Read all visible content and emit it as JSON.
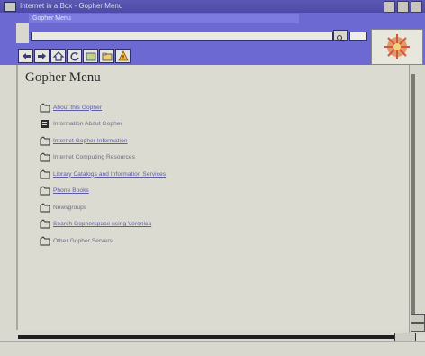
{
  "window": {
    "title": "Internet in a Box - Gopher Menu"
  },
  "menu_strip_text": "Gopher Menu",
  "address": {
    "value": ""
  },
  "toolbar": {
    "icons": [
      "back-icon",
      "forward-icon",
      "home-icon",
      "reload-icon",
      "images-icon",
      "open-icon",
      "stop-icon"
    ]
  },
  "page": {
    "title": "Gopher Menu",
    "items": [
      {
        "label": "About this Gopher",
        "type": "folder",
        "link": true
      },
      {
        "label": "Information About Gopher",
        "type": "document",
        "link": false
      },
      {
        "label": "Internet Gopher Information",
        "type": "folder",
        "link": true
      },
      {
        "label": "Internet Computing Resources",
        "type": "folder",
        "link": false
      },
      {
        "label": "Library Catalogs and Information Services",
        "type": "folder",
        "link": true
      },
      {
        "label": "Phone Books",
        "type": "folder",
        "link": true
      },
      {
        "label": "Newsgroups",
        "type": "folder",
        "link": false
      },
      {
        "label": "Search Gopherspace using Veronica",
        "type": "folder",
        "link": true
      },
      {
        "label": "Other Gopher Servers",
        "type": "folder",
        "link": false
      }
    ]
  },
  "colors": {
    "titlebar": "#4c4aa6",
    "toolbar": "#6c6ad2",
    "link": "#5b5aa8",
    "content_bg": "#dcdbd1"
  }
}
